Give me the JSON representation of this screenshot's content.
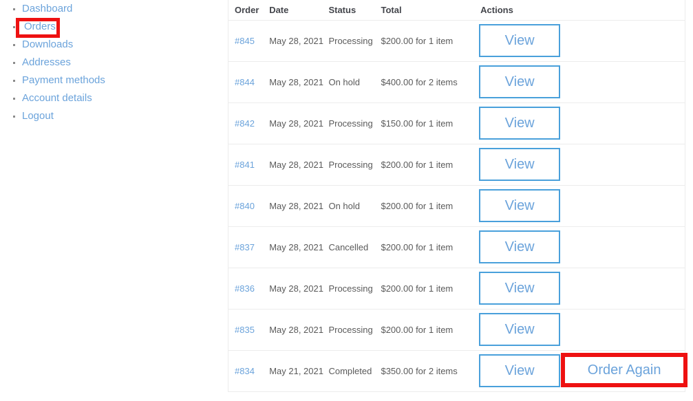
{
  "colors": {
    "link_blue": "#6ba3db",
    "button_border_blue": "#49a0db",
    "highlight_red": "#ee1111",
    "text_gray": "#5a5a5a",
    "header_gray": "#43454b",
    "row_border": "#ececec"
  },
  "sidebar": {
    "items": [
      {
        "label": "Dashboard",
        "highlighted": false
      },
      {
        "label": "Orders",
        "highlighted": true
      },
      {
        "label": "Downloads",
        "highlighted": false
      },
      {
        "label": "Addresses",
        "highlighted": false
      },
      {
        "label": "Payment methods",
        "highlighted": false
      },
      {
        "label": "Account details",
        "highlighted": false
      },
      {
        "label": "Logout",
        "highlighted": false
      }
    ]
  },
  "orders_table": {
    "columns": [
      {
        "key": "order",
        "label": "Order"
      },
      {
        "key": "date",
        "label": "Date"
      },
      {
        "key": "status",
        "label": "Status"
      },
      {
        "key": "total",
        "label": "Total"
      },
      {
        "key": "actions",
        "label": "Actions"
      }
    ],
    "action_labels": {
      "view": "View",
      "order_again": "Order Again"
    },
    "rows": [
      {
        "order": "#845",
        "date": "May 28, 2021",
        "status": "Processing",
        "total": "$200.00 for 1 item",
        "actions": [
          "View"
        ],
        "highlight_order_again": false
      },
      {
        "order": "#844",
        "date": "May 28, 2021",
        "status": "On hold",
        "total": "$400.00 for 2 items",
        "actions": [
          "View"
        ],
        "highlight_order_again": false
      },
      {
        "order": "#842",
        "date": "May 28, 2021",
        "status": "Processing",
        "total": "$150.00 for 1 item",
        "actions": [
          "View"
        ],
        "highlight_order_again": false
      },
      {
        "order": "#841",
        "date": "May 28, 2021",
        "status": "Processing",
        "total": "$200.00 for 1 item",
        "actions": [
          "View"
        ],
        "highlight_order_again": false
      },
      {
        "order": "#840",
        "date": "May 28, 2021",
        "status": "On hold",
        "total": "$200.00 for 1 item",
        "actions": [
          "View"
        ],
        "highlight_order_again": false
      },
      {
        "order": "#837",
        "date": "May 28, 2021",
        "status": "Cancelled",
        "total": "$200.00 for 1 item",
        "actions": [
          "View"
        ],
        "highlight_order_again": false
      },
      {
        "order": "#836",
        "date": "May 28, 2021",
        "status": "Processing",
        "total": "$200.00 for 1 item",
        "actions": [
          "View"
        ],
        "highlight_order_again": false
      },
      {
        "order": "#835",
        "date": "May 28, 2021",
        "status": "Processing",
        "total": "$200.00 for 1 item",
        "actions": [
          "View"
        ],
        "highlight_order_again": false
      },
      {
        "order": "#834",
        "date": "May 21, 2021",
        "status": "Completed",
        "total": "$350.00 for 2 items",
        "actions": [
          "View",
          "Order Again"
        ],
        "highlight_order_again": true
      }
    ]
  }
}
